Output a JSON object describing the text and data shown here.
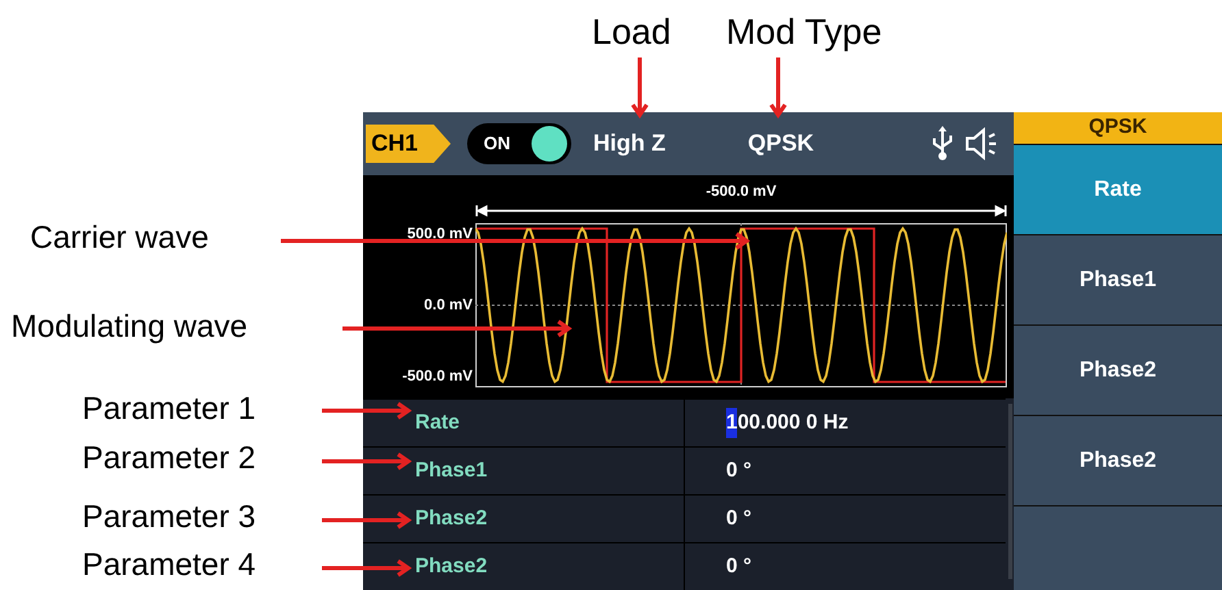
{
  "callouts_top": [
    {
      "label": "Load"
    },
    {
      "label": "Mod Type"
    }
  ],
  "callouts_left": [
    {
      "label": "Carrier wave"
    },
    {
      "label": "Modulating wave"
    },
    {
      "label": "Parameter 1"
    },
    {
      "label": "Parameter 2"
    },
    {
      "label": "Parameter 3"
    },
    {
      "label": "Parameter 4"
    }
  ],
  "header": {
    "channel": "CH1",
    "output": {
      "label": "ON",
      "on": true
    },
    "load": "High Z",
    "mod_type": "QPSK"
  },
  "waveform": {
    "span_label": "-500.0 mV",
    "y_labels": [
      "500.0 mV",
      "0.0 mV",
      "-500.0 mV"
    ]
  },
  "parameters": [
    {
      "name": "Rate",
      "value": "100.000 0 Hz",
      "editing": true
    },
    {
      "name": "Phase1",
      "value": "0 °",
      "editing": false
    },
    {
      "name": "Phase2",
      "value": "0 °",
      "editing": false
    },
    {
      "name": "Phase2",
      "value": "0 °",
      "editing": false
    }
  ],
  "softkeys": {
    "title": "QPSK",
    "items": [
      {
        "label": "Rate",
        "selected": true
      },
      {
        "label": "Phase1",
        "selected": false
      },
      {
        "label": "Phase2",
        "selected": false
      },
      {
        "label": "Phase2",
        "selected": false
      }
    ]
  }
}
